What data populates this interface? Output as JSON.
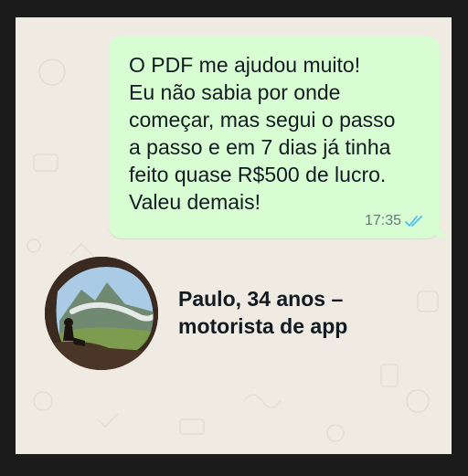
{
  "message": {
    "text": "O PDF me ajudou muito!\nEu não sabia por onde\ncomeçar, mas segui o passo\na passo e em 7 dias já tinha\nfeito quase R$500 de lucro.\nValeu demais!",
    "time": "17:35",
    "status_icon": "double-check-read-icon",
    "tick_color": "#53bdeb"
  },
  "testimonial": {
    "author_line1": "Paulo, 34 anos –",
    "author_line2": "motorista de app"
  },
  "colors": {
    "bubble": "#d9fdd3",
    "background": "#efeae2",
    "frame": "#1b1b1b"
  }
}
